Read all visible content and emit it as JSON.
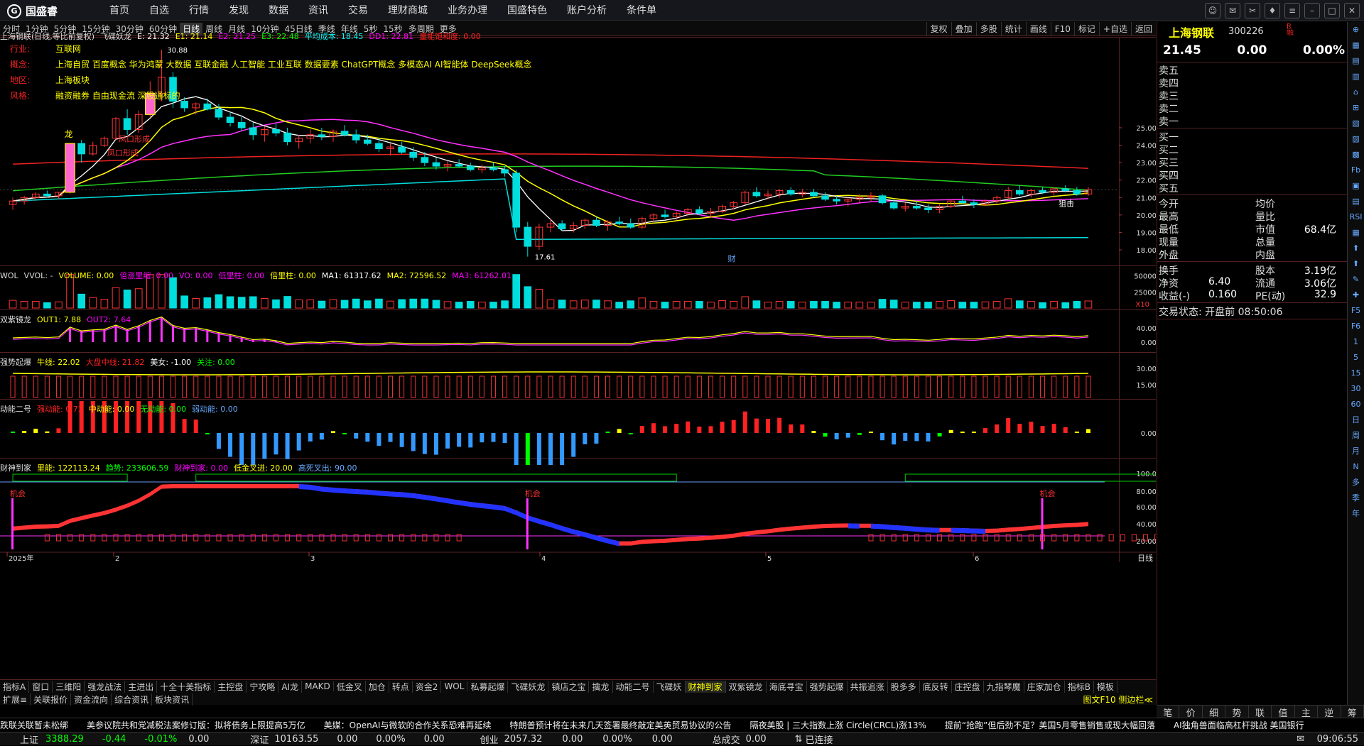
{
  "app": {
    "logo_text": "国盛睿"
  },
  "menu": [
    "首页",
    "自选",
    "行情",
    "发现",
    "数据",
    "资讯",
    "交易",
    "理财商城",
    "业务办理",
    "国盛特色",
    "账户分析",
    "条件单"
  ],
  "periods": [
    "分时",
    "1分钟",
    "5分钟",
    "15分钟",
    "30分钟",
    "60分钟",
    "日线",
    "周线",
    "月线",
    "10分钟",
    "45日线",
    "季线",
    "年线",
    "5秒",
    "15秒",
    "多周期",
    "更多"
  ],
  "active_period": "日线",
  "period_right": [
    "复权",
    "叠加",
    "多股",
    "统计",
    "画线",
    "F10",
    "标记",
    "+自选",
    "返回"
  ],
  "main_header": {
    "title": "上海钢联(日线,等比前复权)",
    "indicator": "飞碟妖龙",
    "e": "E: 21.32",
    "e1": "E1: 21.14",
    "e2": "E2: 21.25",
    "e3": "E3: 22.48",
    "avg": "平均成本: 18.45",
    "dd1": "DD1: 22.81",
    "sat": "量能饱和度: 0.00"
  },
  "info_rows": [
    {
      "k": "行业:",
      "v": "互联网"
    },
    {
      "k": "概念:",
      "v": "上海自贸 百度概念 华为鸿蒙 大数据 互联金融 人工智能 工业互联 数据要素 ChatGPT概念 多模态AI AI智能体 DeepSeek概念"
    },
    {
      "k": "地区:",
      "v": "上海板块"
    },
    {
      "k": "风格:",
      "v": "融资融券 自由现金流 深股通标的"
    }
  ],
  "price_axis": [
    "25.00",
    "24.00",
    "23.00",
    "22.00",
    "21.00",
    "20.00",
    "19.00",
    "18.00"
  ],
  "annotations": {
    "high": "30.88",
    "low": "17.61",
    "dragon": "龙",
    "form1": "凤口形成",
    "form2": "凤口形成",
    "right_note": "狙击",
    "cai": "财"
  },
  "vol_header": {
    "name": "WOL",
    "vvol": "VVOL: -",
    "volume": "VOLUME: 0.00",
    "bei": "倍涨里缩: 0.00",
    "vo": "VO: 0.00",
    "di": "低里柱: 0.00",
    "bei2": "倍里柱: 0.00",
    "ma1": "MA1: 61317.62",
    "ma2": "MA2: 72596.52",
    "ma3": "MA3: 61262.01"
  },
  "vol_axis": [
    "50000",
    "25000"
  ],
  "vol_unit": "X10",
  "ind1_header": {
    "name": "双紫镜龙",
    "out1": "OUT1: 7.88",
    "out2": "OUT2: 7.64"
  },
  "ind1_axis": [
    "40.00",
    "0.00"
  ],
  "ind2_header": {
    "name": "强势起爆",
    "a": "牛线: 22.02",
    "b": "大盘中线: 21.82",
    "c": "美女: -1.00",
    "d": "关注: 0.00"
  },
  "ind2_axis": [
    "30.00",
    "15.00"
  ],
  "ind3_header": {
    "name": "动能二号",
    "a": "强动能: 0.73",
    "b": "中动能: 0.00",
    "c": "无动能: 0.00",
    "d": "弱动能: 0.00"
  },
  "ind3_axis": [
    "0.00"
  ],
  "ind4_header": {
    "name": "财神到家",
    "a": "里能: 122113.24",
    "b": "趋势: 233606.59",
    "c": "财神到家: 0.00",
    "d": "低金叉进: 20.00",
    "e": "高死叉出: 90.00"
  },
  "ind4_axis": [
    "100.0",
    "80.00",
    "60.00",
    "40.00",
    "20.00"
  ],
  "ind4_labels": [
    "机会",
    "机会",
    "机会"
  ],
  "date_axis": [
    "2025年",
    "2",
    "3",
    "4",
    "5",
    "6"
  ],
  "date_unit": "日线",
  "tabs_row1": [
    "指标A",
    "窗口",
    "三维阳",
    "强龙战法",
    "主进出",
    "十全十美指标",
    "主控盘",
    "宁攻略",
    "AI龙",
    "MAKD",
    "低金叉",
    "加仓",
    "转点",
    "资金2",
    "WOL",
    "私募起爆",
    "飞碟妖龙",
    "镇店之宝",
    "擒龙",
    "动能二号",
    "飞碟妖",
    "财神到家",
    "双紫镜龙",
    "海底寻宝",
    "强势起爆",
    "共振追涨",
    "股多多",
    "底反转",
    "庄控盘",
    "九指琴魔",
    "庄家加仓",
    "指标B",
    "模板"
  ],
  "tabs_row1_active": "财神到家",
  "tabs_row2": [
    "扩展≡",
    "关联报价",
    "资金流向",
    "综合资讯",
    "板块资讯"
  ],
  "tabs_row2_right": "图文F10 侧边栏≪",
  "quote": {
    "name": "上海钢联",
    "code": "300226",
    "mark": "R\n融",
    "price": "21.45",
    "change": "0.00",
    "pct": "0.00%",
    "sells": [
      "卖五",
      "卖四",
      "卖三",
      "卖二",
      "卖一"
    ],
    "buys": [
      "买一",
      "买二",
      "买三",
      "买四",
      "买五"
    ],
    "rows1": [
      {
        "l": "今开",
        "r": "均价",
        "v": ""
      },
      {
        "l": "最高",
        "r": "量比",
        "v": ""
      },
      {
        "l": "最低",
        "r": "市值",
        "v": "68.4亿"
      },
      {
        "l": "现量",
        "r": "总量",
        "v": ""
      },
      {
        "l": "外盘",
        "r": "内盘",
        "v": ""
      }
    ],
    "rows2": [
      {
        "l": "换手",
        "lv": "",
        "r": "股本",
        "v": "3.19亿"
      },
      {
        "l": "净资",
        "lv": "6.40",
        "r": "流通",
        "v": "3.06亿"
      },
      {
        "l": "收益(-)",
        "lv": "0.160",
        "r": "PE(动)",
        "v": "32.9"
      }
    ],
    "trade_state": "交易状态: 开盘前 08:50:06"
  },
  "side_tools": [
    "⊕",
    "▦",
    "▤",
    "▥",
    "⌂",
    "⊞",
    "▧",
    "▨",
    "▩",
    "Fb",
    "▣",
    "▤",
    "RSI",
    "▦",
    "⬆",
    "⬆",
    "✎",
    "✚",
    "F5",
    "F6",
    "1",
    "5",
    "15",
    "30",
    "60",
    "日",
    "周",
    "月",
    "N",
    "多",
    "季",
    "年"
  ],
  "right_bottom": [
    "笔",
    "价",
    "细",
    "势",
    "联",
    "值",
    "主",
    "逆",
    "筹"
  ],
  "ticker": [
    "跌联关联暂未松绑",
    "美参议院共和党减税法案修订版：拟将债务上限提高5万亿",
    "美媒：OpenAI与微软的合作关系恐难再延续",
    "特朗普预计将在未来几天签署最终敲定美英贸易协议的公告",
    "隔夜美股 | 三大指数上涨 Circle(CRCL)涨13%",
    "提前“抢跑”但后劲不足？美国5月零售销售或现大幅回落",
    "AI独角兽面临高杠杆挑战 美国银行"
  ],
  "status": {
    "sh": "上证",
    "sh_v": "3388.29",
    "sh_c": "-0.44",
    "sh_p": "-0.01%",
    "sh_a": "0.00",
    "sz": "深证",
    "sz_v": "10163.55",
    "sz_c": "0.00",
    "sz_p": "0.00%",
    "sz_a": "0.00",
    "cy": "创业",
    "cy_v": "2057.32",
    "cy_c": "0.00",
    "cy_p": "0.00%",
    "cy_a": "0.00",
    "amt": "总成交",
    "amt_v": "0.00",
    "conn": "已连接",
    "time": "09:06:55"
  },
  "colors": {
    "up": "#ff3333",
    "down": "#00ffff",
    "bg": "#000000",
    "border": "#552222",
    "ma5": "#ffffff",
    "ma10": "#ffff00",
    "ma20": "#ff00ff",
    "ma60": "#00ff00",
    "ma120": "#ff0000"
  },
  "chart_data": {
    "type": "candlestick",
    "ylim": [
      17.2,
      26.5
    ],
    "x": [
      "2025-01",
      "2025-02",
      "2025-03",
      "2025-04",
      "2025-05",
      "2025-06"
    ],
    "ohlc": [
      [
        20.6,
        21.0,
        20.3,
        20.8
      ],
      [
        20.8,
        21.1,
        20.6,
        21.0
      ],
      [
        21.0,
        21.3,
        20.8,
        21.2
      ],
      [
        21.2,
        21.4,
        21.0,
        21.1
      ],
      [
        21.1,
        21.3,
        20.9,
        21.3
      ],
      [
        21.3,
        24.1,
        21.2,
        24.1
      ],
      [
        24.1,
        24.3,
        23.0,
        23.5
      ],
      [
        23.5,
        24.2,
        23.4,
        24.0
      ],
      [
        24.0,
        24.5,
        23.9,
        24.4
      ],
      [
        24.4,
        25.8,
        24.3,
        25.7
      ],
      [
        25.7,
        26.4,
        24.6,
        24.9
      ],
      [
        24.9,
        26.3,
        24.7,
        26.0
      ],
      [
        26.0,
        28.5,
        25.8,
        27.6
      ],
      [
        27.6,
        30.88,
        27.0,
        28.8
      ],
      [
        28.8,
        29.2,
        26.5,
        27.0
      ],
      [
        27.0,
        27.3,
        26.2,
        26.5
      ],
      [
        26.5,
        26.9,
        26.0,
        26.8
      ],
      [
        26.8,
        27.2,
        26.3,
        26.4
      ],
      [
        26.4,
        26.8,
        25.6,
        25.8
      ],
      [
        25.8,
        26.2,
        25.1,
        25.4
      ],
      [
        25.4,
        25.8,
        24.8,
        25.0
      ],
      [
        25.0,
        25.4,
        24.3,
        24.6
      ],
      [
        24.6,
        25.1,
        24.2,
        24.9
      ],
      [
        24.9,
        25.3,
        24.5,
        24.7
      ],
      [
        24.7,
        25.0,
        24.0,
        24.2
      ],
      [
        24.2,
        24.6,
        23.8,
        24.4
      ],
      [
        24.4,
        24.9,
        24.1,
        24.6
      ],
      [
        24.6,
        25.0,
        24.3,
        24.5
      ],
      [
        24.5,
        24.9,
        24.2,
        24.8
      ],
      [
        24.8,
        25.2,
        24.5,
        24.6
      ],
      [
        24.6,
        24.9,
        24.1,
        24.3
      ],
      [
        24.3,
        24.6,
        24.0,
        24.1
      ],
      [
        24.1,
        24.4,
        23.6,
        23.8
      ],
      [
        23.8,
        24.1,
        23.4,
        23.9
      ],
      [
        23.9,
        24.2,
        23.5,
        23.6
      ],
      [
        23.6,
        23.9,
        23.1,
        23.3
      ],
      [
        23.3,
        23.6,
        22.8,
        23.0
      ],
      [
        23.0,
        23.3,
        22.6,
        22.8
      ],
      [
        22.8,
        23.1,
        22.5,
        22.9
      ],
      [
        22.9,
        23.2,
        22.7,
        22.8
      ],
      [
        22.8,
        23.0,
        22.5,
        22.6
      ],
      [
        22.6,
        22.9,
        22.4,
        22.7
      ],
      [
        22.7,
        23.0,
        22.5,
        22.6
      ],
      [
        22.6,
        22.8,
        22.2,
        22.4
      ],
      [
        22.4,
        22.6,
        19.0,
        19.3
      ],
      [
        19.3,
        19.6,
        17.61,
        18.2
      ],
      [
        18.2,
        19.5,
        18.0,
        19.3
      ],
      [
        19.3,
        19.8,
        19.0,
        19.5
      ],
      [
        19.5,
        19.7,
        19.1,
        19.2
      ],
      [
        19.2,
        19.6,
        19.0,
        19.4
      ],
      [
        19.4,
        19.8,
        19.2,
        19.7
      ],
      [
        19.7,
        19.9,
        19.3,
        19.4
      ],
      [
        19.4,
        19.7,
        19.1,
        19.6
      ],
      [
        19.6,
        19.9,
        19.4,
        19.5
      ],
      [
        19.5,
        19.8,
        19.2,
        19.3
      ],
      [
        19.3,
        19.9,
        19.2,
        19.8
      ],
      [
        19.8,
        20.1,
        19.6,
        20.0
      ],
      [
        20.0,
        20.3,
        19.8,
        19.9
      ],
      [
        19.9,
        20.2,
        19.7,
        20.1
      ],
      [
        20.1,
        20.4,
        19.9,
        20.3
      ],
      [
        20.3,
        20.5,
        20.0,
        20.1
      ],
      [
        20.1,
        20.4,
        19.9,
        20.2
      ],
      [
        20.2,
        20.6,
        20.1,
        20.5
      ],
      [
        20.5,
        20.8,
        20.3,
        20.7
      ],
      [
        20.7,
        21.4,
        20.6,
        21.3
      ],
      [
        21.3,
        21.6,
        21.0,
        21.1
      ],
      [
        21.1,
        21.4,
        20.9,
        21.2
      ],
      [
        21.2,
        21.5,
        21.0,
        21.4
      ],
      [
        21.4,
        21.6,
        21.1,
        21.2
      ],
      [
        21.2,
        21.5,
        21.0,
        21.3
      ],
      [
        21.3,
        21.5,
        21.0,
        21.1
      ],
      [
        21.1,
        21.3,
        20.8,
        20.9
      ],
      [
        20.9,
        21.1,
        20.6,
        20.8
      ],
      [
        20.8,
        21.0,
        20.5,
        20.9
      ],
      [
        20.9,
        21.2,
        20.7,
        21.0
      ],
      [
        21.0,
        21.3,
        20.8,
        21.1
      ],
      [
        21.1,
        21.2,
        20.6,
        20.7
      ],
      [
        20.7,
        20.9,
        20.3,
        20.4
      ],
      [
        20.4,
        20.7,
        20.2,
        20.5
      ],
      [
        20.5,
        20.8,
        20.3,
        20.4
      ],
      [
        20.4,
        20.6,
        20.1,
        20.3
      ],
      [
        20.3,
        20.6,
        20.1,
        20.5
      ],
      [
        20.5,
        20.9,
        20.4,
        20.8
      ],
      [
        20.8,
        21.1,
        20.6,
        20.7
      ],
      [
        20.7,
        20.9,
        20.4,
        20.6
      ],
      [
        20.6,
        20.9,
        20.5,
        20.8
      ],
      [
        20.8,
        21.1,
        20.6,
        21.0
      ],
      [
        21.0,
        21.6,
        20.9,
        21.4
      ],
      [
        21.4,
        21.7,
        21.1,
        21.2
      ],
      [
        21.2,
        21.5,
        21.0,
        21.4
      ],
      [
        21.4,
        21.6,
        21.2,
        21.3
      ],
      [
        21.3,
        21.6,
        21.1,
        21.5
      ],
      [
        21.5,
        21.7,
        21.3,
        21.4
      ],
      [
        21.4,
        21.6,
        21.1,
        21.2
      ],
      [
        21.2,
        21.6,
        21.1,
        21.45
      ]
    ]
  }
}
